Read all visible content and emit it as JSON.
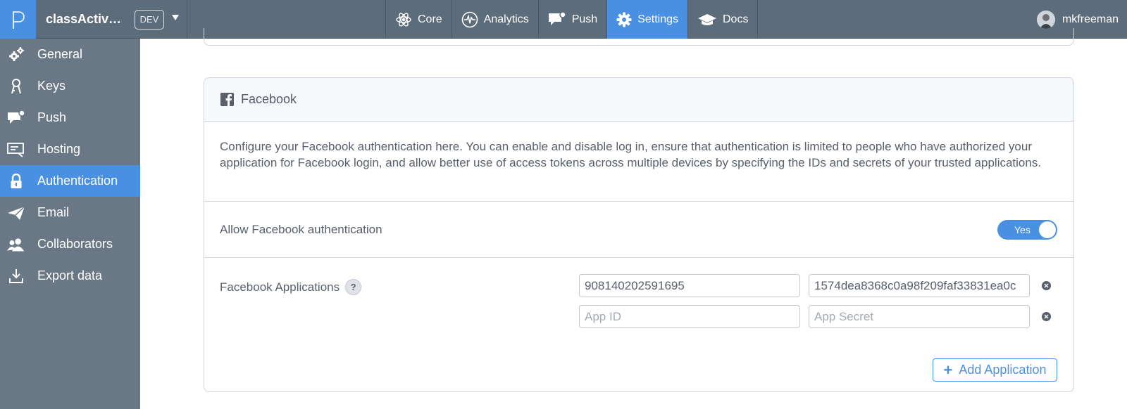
{
  "app": {
    "name": "classActiv…",
    "env_badge": "DEV"
  },
  "nav": [
    {
      "label": "Core",
      "icon": "atom-icon",
      "active": false
    },
    {
      "label": "Analytics",
      "icon": "pulse-icon",
      "active": false
    },
    {
      "label": "Push",
      "icon": "chat-bubble-icon",
      "active": false
    },
    {
      "label": "Settings",
      "icon": "gear-icon",
      "active": true
    },
    {
      "label": "Docs",
      "icon": "mortarboard-icon",
      "active": false
    }
  ],
  "user": {
    "name": "mkfreeman"
  },
  "sidebar": {
    "items": [
      {
        "label": "General",
        "icon": "gears-icon",
        "active": false
      },
      {
        "label": "Keys",
        "icon": "keys-icon",
        "active": false
      },
      {
        "label": "Push",
        "icon": "chat-bubble-icon",
        "active": false
      },
      {
        "label": "Hosting",
        "icon": "monitor-icon",
        "active": false
      },
      {
        "label": "Authentication",
        "icon": "lock-icon",
        "active": true
      },
      {
        "label": "Email",
        "icon": "paper-plane-icon",
        "active": false
      },
      {
        "label": "Collaborators",
        "icon": "users-icon",
        "active": false
      },
      {
        "label": "Export data",
        "icon": "download-icon",
        "active": false
      }
    ]
  },
  "facebook": {
    "title": "Facebook",
    "description": "Configure your Facebook authentication here. You can enable and disable log in, ensure that authentication is limited to people who have authorized your application for Facebook login, and allow better use of access tokens across multiple devices by specifying the IDs and secrets of your trusted applications.",
    "allow_label": "Allow Facebook authentication",
    "toggle_label": "Yes",
    "toggle_on": true,
    "apps_label": "Facebook Applications",
    "help_label": "?",
    "apps": [
      {
        "app_id": "908140202591695",
        "app_secret": "1574dea8368c0a98f209faf33831ea0c"
      },
      {
        "app_id": "",
        "app_secret": ""
      }
    ],
    "placeholders": {
      "app_id": "App ID",
      "app_secret": "App Secret"
    },
    "add_label": "Add Application",
    "add_icon": "+"
  },
  "colors": {
    "accent": "#4a90e2",
    "topbar": "#5d6c7a",
    "sidebar": "#6a7885"
  }
}
